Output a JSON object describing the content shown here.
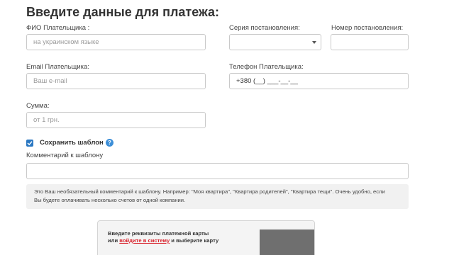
{
  "form": {
    "title": "Введите данные для платежа:",
    "fio": {
      "label": "ФИО Плательщика :",
      "placeholder": "на украинском языке"
    },
    "series": {
      "label": "Серия постановления:",
      "value": ""
    },
    "number": {
      "label": "Номер постановления:",
      "value": ""
    },
    "email": {
      "label": "Email Плательщика:",
      "placeholder": "Ваш e-mail"
    },
    "phone": {
      "label": "Телефон Плательщика:",
      "value": "+380 (__) ___-__-__"
    },
    "amount": {
      "label": "Сумма:",
      "placeholder": "от 1 грн."
    },
    "save_template": {
      "label": "Сохранить шаблон",
      "checked": true,
      "help_icon": "question-circle-icon",
      "help_symbol": "?"
    },
    "comment": {
      "label": "Комментарий к шаблону",
      "value": ""
    },
    "hint": {
      "line1": "Это Ваш необязательный комментарий к шаблону. Например: \"Моя квартира\", \"Квартира родителей\", \"Квартира тещи\". Очень удобно, если",
      "line2": "Вы будете оплачивать несколько счетов от одной компании."
    }
  },
  "card_prompt": {
    "line1": "Введите реквизиты платежной карты",
    "line2_prefix": "или ",
    "link": "войдите в систему",
    "line2_suffix": " и выберите карту"
  },
  "colors": {
    "accent": "#2b78c2",
    "link": "#d9232d",
    "hint_bg": "#f1f1f1"
  }
}
